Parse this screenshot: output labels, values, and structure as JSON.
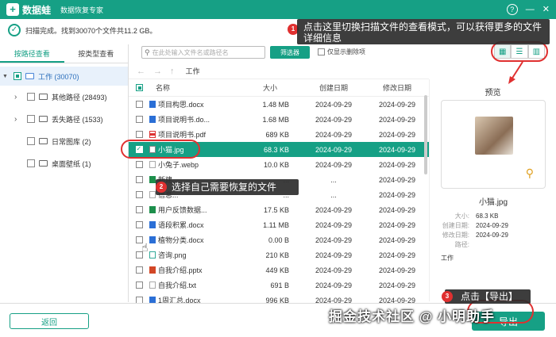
{
  "titlebar": {
    "logo_mark": "+",
    "app_name": "数据蛙",
    "app_sub": "数据恢复专家",
    "help_icon": "?",
    "min_icon": "—",
    "close_icon": "✕"
  },
  "status": {
    "text": "扫描完成。找到30070个文件共11.2 GB。"
  },
  "left": {
    "tabs": [
      "按路径查看",
      "按类型查看"
    ],
    "root": {
      "label": "工作 (30070)"
    },
    "items": [
      {
        "label": "其他路径 (28493)",
        "chevron": true
      },
      {
        "label": "丢失路径 (1533)",
        "chevron": true
      },
      {
        "label": "日常图库 (2)",
        "chevron": false
      },
      {
        "label": "桌面壁纸 (1)",
        "chevron": false
      }
    ]
  },
  "toolbar": {
    "search_placeholder": "在此处输入文件名或路径名",
    "filter_label": "筛选器",
    "show_deleted_label": "仅显示删除项"
  },
  "nav": {
    "back": "←",
    "forward": "→",
    "up": "↑",
    "path": "工作"
  },
  "table": {
    "headers": {
      "name": "名称",
      "size": "大小",
      "created": "创建日期",
      "modified": "修改日期"
    },
    "rows": [
      {
        "name": "项目构思.docx",
        "size": "1.48 MB",
        "created": "2024-09-29",
        "modified": "2024-09-29",
        "type": "docx"
      },
      {
        "name": "项目说明书.do...",
        "size": "1.68 MB",
        "created": "2024-09-29",
        "modified": "2024-09-29",
        "type": "docx"
      },
      {
        "name": "项目说明书.pdf",
        "size": "689 KB",
        "created": "2024-09-29",
        "modified": "2024-09-29",
        "type": "pdf"
      },
      {
        "name": "小猫.jpg",
        "size": "68.3 KB",
        "created": "2024-09-29",
        "modified": "2024-09-29",
        "type": "jpg"
      },
      {
        "name": "小兔子.webp",
        "size": "10.0 KB",
        "created": "2024-09-29",
        "modified": "2024-09-29",
        "type": "webp"
      },
      {
        "name": "新建...",
        "size": "...",
        "created": "...",
        "modified": "2024-09-29",
        "type": "xlsx"
      },
      {
        "name": "信息...",
        "size": "...",
        "created": "...",
        "modified": "2024-09-29",
        "type": "txt"
      },
      {
        "name": "用户反馈数据...",
        "size": "17.5 KB",
        "created": "2024-09-29",
        "modified": "2024-09-29",
        "type": "xlsx"
      },
      {
        "name": "语段积累.docx",
        "size": "1.11 MB",
        "created": "2024-09-29",
        "modified": "2024-09-29",
        "type": "docx"
      },
      {
        "name": "植物分类.docx",
        "size": "0.00 B",
        "created": "2024-09-29",
        "modified": "2024-09-29",
        "type": "docx"
      },
      {
        "name": "咨询.png",
        "size": "210 KB",
        "created": "2024-09-29",
        "modified": "2024-09-29",
        "type": "png"
      },
      {
        "name": "自我介绍.pptx",
        "size": "449 KB",
        "created": "2024-09-29",
        "modified": "2024-09-29",
        "type": "pptx"
      },
      {
        "name": "自我介绍.txt",
        "size": "691 B",
        "created": "2024-09-29",
        "modified": "2024-09-29",
        "type": "txt"
      },
      {
        "name": "1周汇总.docx",
        "size": "996 KB",
        "created": "2024-09-29",
        "modified": "2024-09-29",
        "type": "docx"
      }
    ],
    "selected_index": 3
  },
  "preview": {
    "title": "预览",
    "filename": "小猫.jpg",
    "meta": [
      {
        "k": "大小:",
        "v": "68.3 KB"
      },
      {
        "k": "创建日期:",
        "v": "2024-09-29"
      },
      {
        "k": "修改日期:",
        "v": "2024-09-29"
      },
      {
        "k": "路径:",
        "v": ""
      }
    ],
    "path_value": "工作"
  },
  "bottom": {
    "back_label": "返回",
    "export_label": "导出"
  },
  "annotations": {
    "badge1": "1",
    "callout1": "点击这里切换扫描文件的查看模式，可以获得更多的文件详细信息",
    "badge2": "2",
    "callout2": "选择自己需要恢复的文件",
    "badge3": "3",
    "callout3": "点击【导出】"
  },
  "watermark": "掘金技术社区 @ 小明助手",
  "colors": {
    "accent": "#16a085",
    "annotation_red": "#e03030"
  }
}
